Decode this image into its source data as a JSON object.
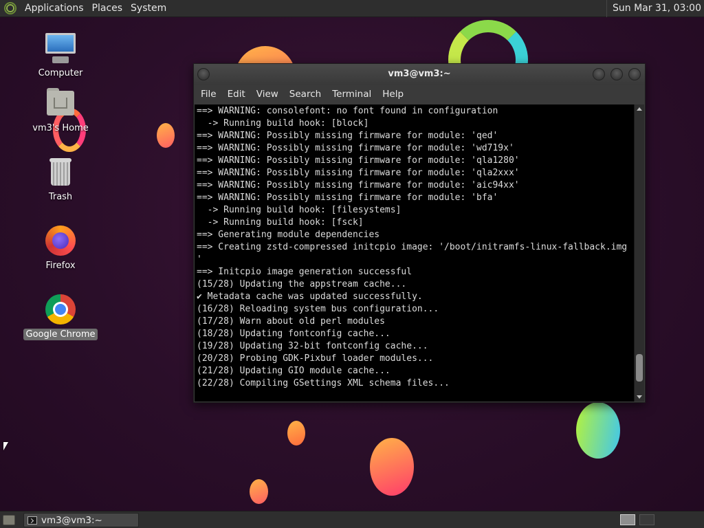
{
  "top_panel": {
    "menus": [
      "Applications",
      "Places",
      "System"
    ],
    "clock": "Sun Mar 31, 03:00"
  },
  "desktop_icons": [
    {
      "label": "Computer",
      "icon": "computer-icon"
    },
    {
      "label": "vm3's Home",
      "icon": "home-folder-icon"
    },
    {
      "label": "Trash",
      "icon": "trash-icon"
    },
    {
      "label": "Firefox",
      "icon": "firefox-icon"
    },
    {
      "label": "Google Chrome",
      "icon": "chrome-icon",
      "selected": true
    }
  ],
  "terminal": {
    "title": "vm3@vm3:~",
    "menus": [
      "File",
      "Edit",
      "View",
      "Search",
      "Terminal",
      "Help"
    ],
    "lines": [
      "==> WARNING: consolefont: no font found in configuration",
      "  -> Running build hook: [block]",
      "==> WARNING: Possibly missing firmware for module: 'qed'",
      "==> WARNING: Possibly missing firmware for module: 'wd719x'",
      "==> WARNING: Possibly missing firmware for module: 'qla1280'",
      "==> WARNING: Possibly missing firmware for module: 'qla2xxx'",
      "==> WARNING: Possibly missing firmware for module: 'aic94xx'",
      "==> WARNING: Possibly missing firmware for module: 'bfa'",
      "  -> Running build hook: [filesystems]",
      "  -> Running build hook: [fsck]",
      "==> Generating module dependencies",
      "==> Creating zstd-compressed initcpio image: '/boot/initramfs-linux-fallback.img",
      "'",
      "==> Initcpio image generation successful",
      "(15/28) Updating the appstream cache...",
      "✔ Metadata cache was updated successfully.",
      "(16/28) Reloading system bus configuration...",
      "(17/28) Warn about old perl modules",
      "(18/28) Updating fontconfig cache...",
      "(19/28) Updating 32-bit fontconfig cache...",
      "(20/28) Probing GDK-Pixbuf loader modules...",
      "(21/28) Updating GIO module cache...",
      "(22/28) Compiling GSettings XML schema files..."
    ],
    "scroll_position": 0.96
  },
  "bottom_panel": {
    "task_label": "vm3@vm3:~"
  }
}
